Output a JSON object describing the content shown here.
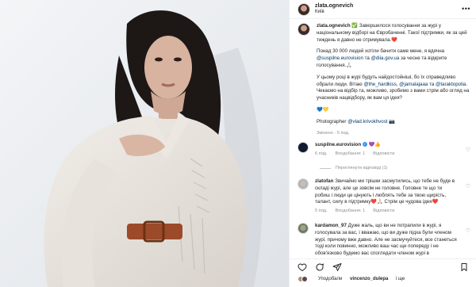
{
  "post": {
    "username": "zlata.ognevich",
    "location": "Київ",
    "more_icon": "more-horizontal-icon"
  },
  "caption": {
    "username": "zlata.ognevich",
    "p1": "✅ Завершилося голосування за журі у національному відборі на Євробаченні. Такої підтримки, як за цей тиждень я давно не отримувала.❤️",
    "p2_a": "Понад 30 000 людей хотіли бачити саме мене, я вдячна ",
    "p2_mention1": "@suspilne.eurovision",
    "p2_b": " та ",
    "p2_mention2": "@diia.gov.ua",
    "p2_c": " за чесне та відкрите голосування.🙏🏻",
    "p3_a": "У цьому році в журі будуть найдостойніші, бо їх справедливо обрали люди. Вітаю ",
    "p3_mention1": "@the_hardkiss",
    "p3_b": ", ",
    "p3_mention2": "@jamalajaaa",
    "p3_c": " та ",
    "p3_mention3": "@taraktopolia",
    "p3_d": ". Чекаємо на відбір та, можливо, зробимо з вами стрім або огляд на учасників нацвідбору, як вам ця ідея?",
    "p4": "💙💛",
    "p5_a": "Photographer ",
    "p5_mention": "@vlad.krivokhvost",
    "p5_b": " 📷",
    "meta": "Змінено · 5 под."
  },
  "comments": [
    {
      "username": "suspilne.eurovision",
      "text": " 💜👍",
      "time": "6 под.",
      "likes": "Вподобання: 1",
      "reply": "Відповісти",
      "translation": "Переглянути відповіді (1)"
    },
    {
      "username": "zlatofan",
      "text": " Звичайно ми трішки засмутились, що тебе не буде в складі журі, але це зовсім не головне. Головне те що ти робиш і люди це цінують і люблять тебе за твою щирість, талант, силу в підтримку❤️🙏🏻 Стрім це чудова ідея❤️",
      "time": "5 под.",
      "likes": "Вподобання: 1",
      "reply": "Відповісти"
    },
    {
      "username": "kardamon_97",
      "text": " Дуже жаль, що ви не потрапили в журі, я голосувала за вас, і вважаю, що ви дуже підха були членом журі, причому вже давно. Але не засмучуйтеся, все станеться тоді коли повинно, можливо ваш час ще попереду і не обов'язково будемо вас споглядати членом журі в",
      "time": "5 под.",
      "likes": "Вподобання: 2",
      "reply": "Відповісти"
    }
  ],
  "actions": {
    "like_icon": "heart-icon",
    "comment_icon": "comment-icon",
    "share_icon": "share-icon",
    "save_icon": "bookmark-icon"
  },
  "likes_line": {
    "prefix": "Уподобали ",
    "user": "vincenzo_dulepa",
    "suffix": " і ще"
  },
  "colors": {
    "link": "#00376b",
    "muted": "#8e8e8e",
    "verified": "#3897f0"
  }
}
